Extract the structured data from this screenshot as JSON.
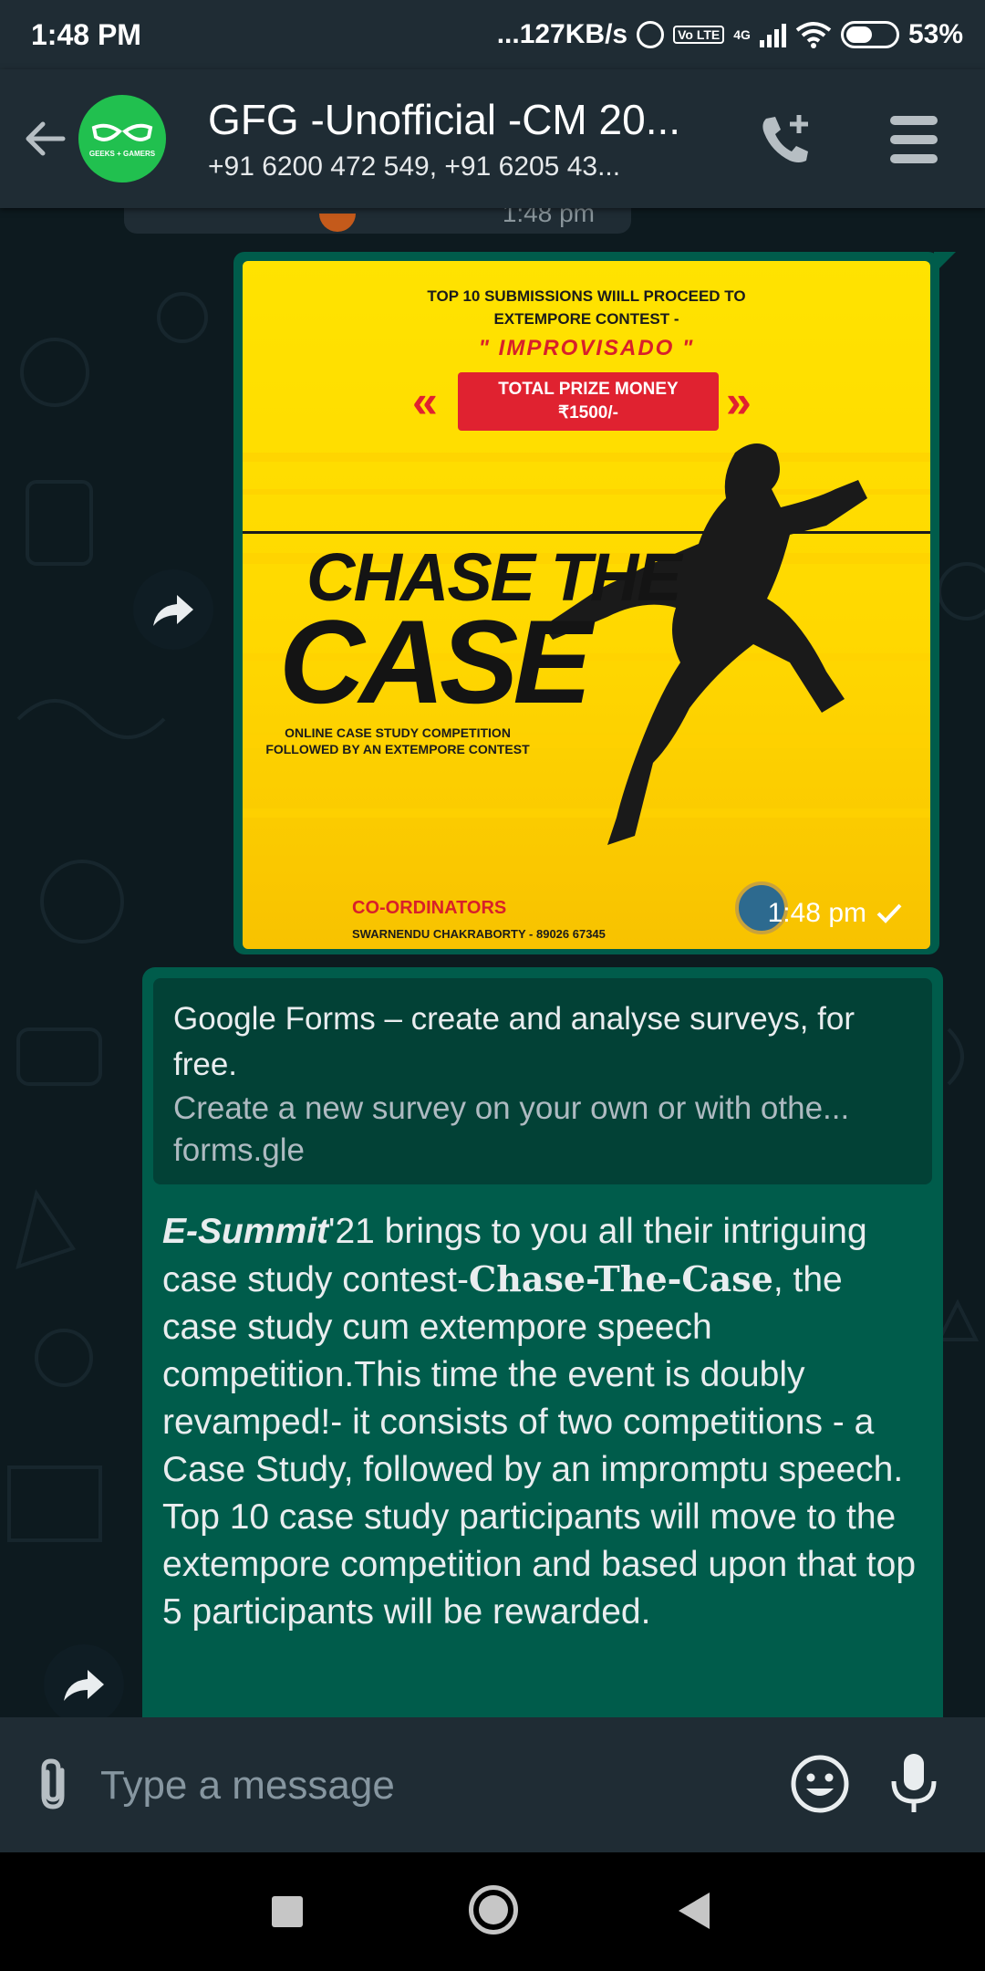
{
  "status_bar": {
    "time": "1:48 PM",
    "network_speed": "...127KB/s",
    "volte": "Vo LTE",
    "network_type": "4G",
    "battery": "53%",
    "battery_level": 0.53
  },
  "header": {
    "title": "GFG -Unofficial -CM 20...",
    "subtitle": "+91 6200 472 549, +91 6205 43...",
    "avatar_caption": "GEEKS + GAMERS",
    "avatar_color": "#21c04f"
  },
  "messages": {
    "previous_time": "1:48 pm",
    "image": {
      "top_text_1": "TOP 10 SUBMISSIONS WIILL PROCEED TO",
      "top_text_2": "EXTEMPORE CONTEST -",
      "contest_name": "\" IMPROVISADO \"",
      "prize_1": "TOTAL PRIZE MONEY",
      "prize_2": "₹1500/-",
      "headline_1": "CHASE THE",
      "headline_2": "CASE",
      "caption_1": "ONLINE CASE STUDY COMPETITION",
      "caption_2": "FOLLOWED BY AN EXTEMPORE CONTEST",
      "coordinators_label": "CO-ORDINATORS",
      "coordinator": "SWARNENDU CHAKRABORTY - 89026 67345",
      "time": "1:48 pm",
      "status_icon": "check-icon"
    },
    "link_preview": {
      "title": "Google Forms – create and analyse surveys, for free.",
      "description": "Create a new survey on your own or with othe...",
      "domain": "forms.gle"
    },
    "text": {
      "emph": "E-Summit",
      "part1": "'21 brings to you all their intriguing case study contest-",
      "serif": "Chase-The-Case",
      "part2": ", the case study cum extempore speech competition.This time the event is doubly revamped!- it consists of two competitions -  a Case Study, followed by an impromptu speech. Top 10 case study participants will move to the extempore competition and based upon that top 5 participants will be rewarded."
    }
  },
  "input": {
    "placeholder": "Type a message"
  },
  "colors": {
    "header_bg": "#1f2c34",
    "bubble_out": "#005c4b",
    "link_preview_bg": "#024136",
    "poster_yellow": "#ffe300",
    "poster_red": "#e02230"
  }
}
